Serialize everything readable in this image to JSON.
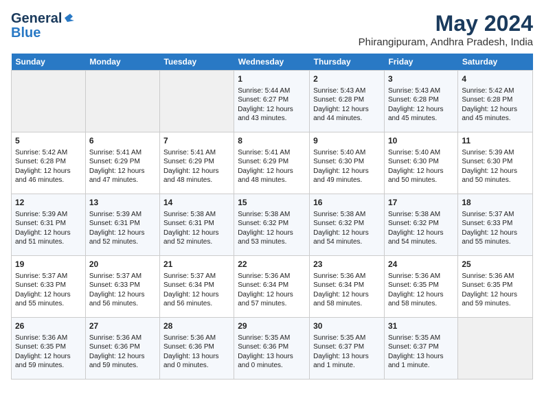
{
  "logo": {
    "line1": "General",
    "line2": "Blue"
  },
  "title": "May 2024",
  "subtitle": "Phirangipuram, Andhra Pradesh, India",
  "days_of_week": [
    "Sunday",
    "Monday",
    "Tuesday",
    "Wednesday",
    "Thursday",
    "Friday",
    "Saturday"
  ],
  "weeks": [
    [
      {
        "day": "",
        "info": ""
      },
      {
        "day": "",
        "info": ""
      },
      {
        "day": "",
        "info": ""
      },
      {
        "day": "1",
        "info": "Sunrise: 5:44 AM\nSunset: 6:27 PM\nDaylight: 12 hours\nand 43 minutes."
      },
      {
        "day": "2",
        "info": "Sunrise: 5:43 AM\nSunset: 6:28 PM\nDaylight: 12 hours\nand 44 minutes."
      },
      {
        "day": "3",
        "info": "Sunrise: 5:43 AM\nSunset: 6:28 PM\nDaylight: 12 hours\nand 45 minutes."
      },
      {
        "day": "4",
        "info": "Sunrise: 5:42 AM\nSunset: 6:28 PM\nDaylight: 12 hours\nand 45 minutes."
      }
    ],
    [
      {
        "day": "5",
        "info": "Sunrise: 5:42 AM\nSunset: 6:28 PM\nDaylight: 12 hours\nand 46 minutes."
      },
      {
        "day": "6",
        "info": "Sunrise: 5:41 AM\nSunset: 6:29 PM\nDaylight: 12 hours\nand 47 minutes."
      },
      {
        "day": "7",
        "info": "Sunrise: 5:41 AM\nSunset: 6:29 PM\nDaylight: 12 hours\nand 48 minutes."
      },
      {
        "day": "8",
        "info": "Sunrise: 5:41 AM\nSunset: 6:29 PM\nDaylight: 12 hours\nand 48 minutes."
      },
      {
        "day": "9",
        "info": "Sunrise: 5:40 AM\nSunset: 6:30 PM\nDaylight: 12 hours\nand 49 minutes."
      },
      {
        "day": "10",
        "info": "Sunrise: 5:40 AM\nSunset: 6:30 PM\nDaylight: 12 hours\nand 50 minutes."
      },
      {
        "day": "11",
        "info": "Sunrise: 5:39 AM\nSunset: 6:30 PM\nDaylight: 12 hours\nand 50 minutes."
      }
    ],
    [
      {
        "day": "12",
        "info": "Sunrise: 5:39 AM\nSunset: 6:31 PM\nDaylight: 12 hours\nand 51 minutes."
      },
      {
        "day": "13",
        "info": "Sunrise: 5:39 AM\nSunset: 6:31 PM\nDaylight: 12 hours\nand 52 minutes."
      },
      {
        "day": "14",
        "info": "Sunrise: 5:38 AM\nSunset: 6:31 PM\nDaylight: 12 hours\nand 52 minutes."
      },
      {
        "day": "15",
        "info": "Sunrise: 5:38 AM\nSunset: 6:32 PM\nDaylight: 12 hours\nand 53 minutes."
      },
      {
        "day": "16",
        "info": "Sunrise: 5:38 AM\nSunset: 6:32 PM\nDaylight: 12 hours\nand 54 minutes."
      },
      {
        "day": "17",
        "info": "Sunrise: 5:38 AM\nSunset: 6:32 PM\nDaylight: 12 hours\nand 54 minutes."
      },
      {
        "day": "18",
        "info": "Sunrise: 5:37 AM\nSunset: 6:33 PM\nDaylight: 12 hours\nand 55 minutes."
      }
    ],
    [
      {
        "day": "19",
        "info": "Sunrise: 5:37 AM\nSunset: 6:33 PM\nDaylight: 12 hours\nand 55 minutes."
      },
      {
        "day": "20",
        "info": "Sunrise: 5:37 AM\nSunset: 6:33 PM\nDaylight: 12 hours\nand 56 minutes."
      },
      {
        "day": "21",
        "info": "Sunrise: 5:37 AM\nSunset: 6:34 PM\nDaylight: 12 hours\nand 56 minutes."
      },
      {
        "day": "22",
        "info": "Sunrise: 5:36 AM\nSunset: 6:34 PM\nDaylight: 12 hours\nand 57 minutes."
      },
      {
        "day": "23",
        "info": "Sunrise: 5:36 AM\nSunset: 6:34 PM\nDaylight: 12 hours\nand 58 minutes."
      },
      {
        "day": "24",
        "info": "Sunrise: 5:36 AM\nSunset: 6:35 PM\nDaylight: 12 hours\nand 58 minutes."
      },
      {
        "day": "25",
        "info": "Sunrise: 5:36 AM\nSunset: 6:35 PM\nDaylight: 12 hours\nand 59 minutes."
      }
    ],
    [
      {
        "day": "26",
        "info": "Sunrise: 5:36 AM\nSunset: 6:35 PM\nDaylight: 12 hours\nand 59 minutes."
      },
      {
        "day": "27",
        "info": "Sunrise: 5:36 AM\nSunset: 6:36 PM\nDaylight: 12 hours\nand 59 minutes."
      },
      {
        "day": "28",
        "info": "Sunrise: 5:36 AM\nSunset: 6:36 PM\nDaylight: 13 hours\nand 0 minutes."
      },
      {
        "day": "29",
        "info": "Sunrise: 5:35 AM\nSunset: 6:36 PM\nDaylight: 13 hours\nand 0 minutes."
      },
      {
        "day": "30",
        "info": "Sunrise: 5:35 AM\nSunset: 6:37 PM\nDaylight: 13 hours\nand 1 minute."
      },
      {
        "day": "31",
        "info": "Sunrise: 5:35 AM\nSunset: 6:37 PM\nDaylight: 13 hours\nand 1 minute."
      },
      {
        "day": "",
        "info": ""
      }
    ]
  ]
}
